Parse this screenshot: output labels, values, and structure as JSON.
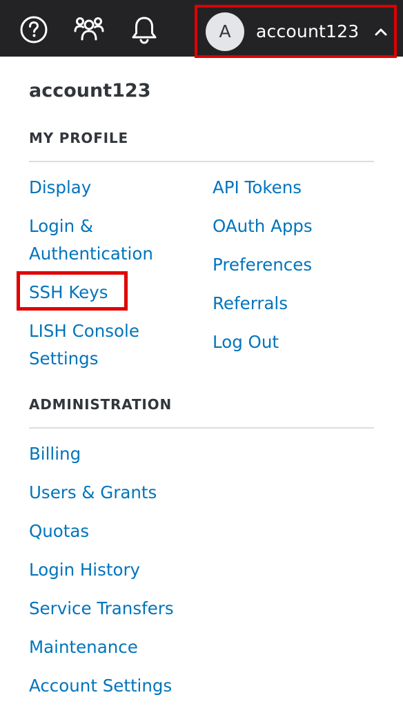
{
  "topbar": {
    "icons": [
      "help-icon",
      "community-icon",
      "notifications-icon"
    ],
    "account": {
      "avatar_letter": "A",
      "username": "account123",
      "caret_icon": "chevron-up-icon"
    }
  },
  "menu": {
    "username": "account123",
    "my_profile": {
      "heading": "MY PROFILE",
      "left_links": [
        "Display",
        "Login &",
        "Authentication",
        "SSH Keys",
        "LISH Console",
        "Settings"
      ],
      "right_links": [
        "API Tokens",
        "OAuth Apps",
        "Preferences",
        "Referrals",
        "Log Out"
      ]
    },
    "administration": {
      "heading": "ADMINISTRATION",
      "links": [
        "Billing",
        "Users & Grants",
        "Quotas",
        "Login History",
        "Service Transfers",
        "Maintenance",
        "Account Settings"
      ]
    }
  },
  "colors": {
    "topbar_bg": "#232326",
    "link": "#0174bc",
    "highlight": "#e00000"
  }
}
